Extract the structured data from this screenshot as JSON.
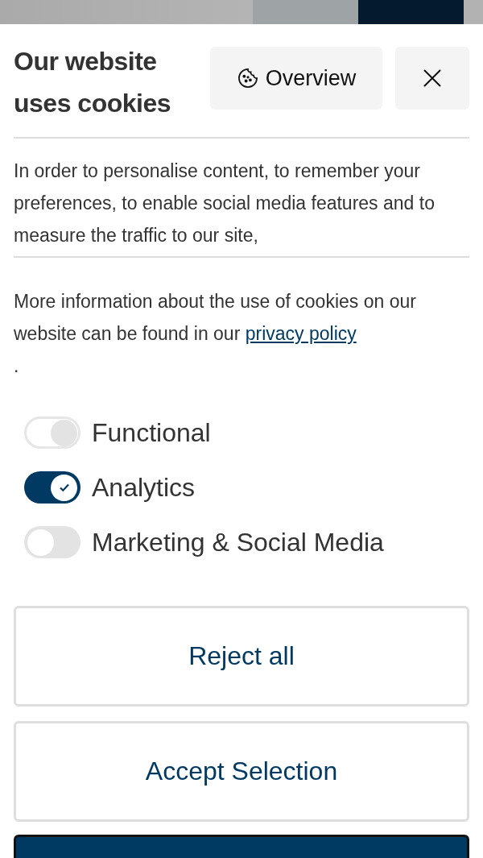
{
  "dialog": {
    "title": "Our website uses cookies",
    "overview_button": {
      "label": "Overview"
    },
    "intro_text": "In order to personalise content, to remember your preferences, to enable social media features and to measure the traffic to our site,",
    "info_text": "More information about the use of cookies on our website can be found in our",
    "privacy_link": "privacy policy",
    "info_end": ".",
    "categories": [
      {
        "label": "Functional",
        "checked": true,
        "disabled": true
      },
      {
        "label": "Analytics",
        "checked": true,
        "disabled": false
      },
      {
        "label": "Marketing & Social Media",
        "checked": false,
        "disabled": false
      }
    ],
    "buttons": [
      {
        "label": "Reject all",
        "kind": "outline"
      },
      {
        "label": "Accept Selection",
        "kind": "outline"
      },
      {
        "kind": "primary"
      }
    ]
  }
}
